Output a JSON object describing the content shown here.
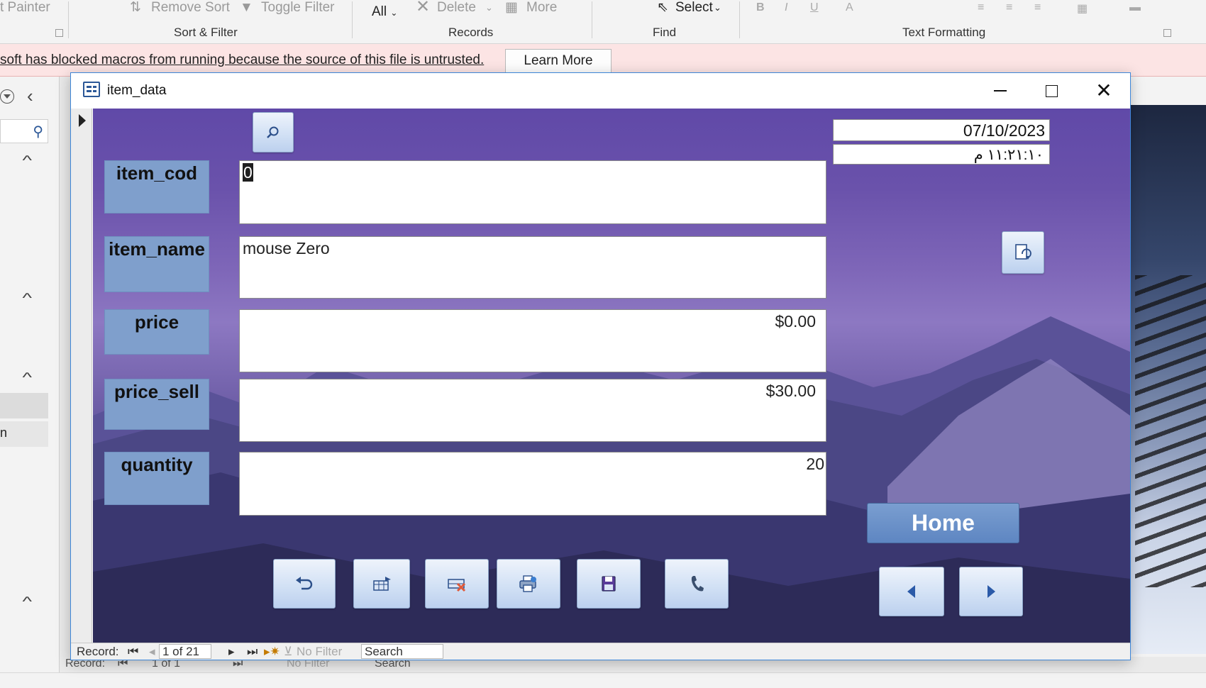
{
  "ribbon": {
    "painter_label": "t Painter",
    "remove_sort_label": "Remove Sort",
    "toggle_filter_label": "Toggle Filter",
    "all_label": "All",
    "delete_label": "Delete",
    "more_label": "More",
    "select_label": "Select",
    "groups": {
      "sort_filter": "Sort & Filter",
      "records": "Records",
      "find": "Find",
      "text_formatting": "Text Formatting"
    }
  },
  "message_bar": {
    "text": "soft has blocked macros from running because the source of this file is untrusted.",
    "learn_more_label": "Learn More"
  },
  "nav_pane": {
    "partial_item_text": "n"
  },
  "window": {
    "title": "item_data",
    "close_glyph": "✕"
  },
  "form": {
    "date": "07/10/2023",
    "time": "١١:٢١:١٠ م",
    "home_label": "Home",
    "fields": [
      {
        "label": "item_cod",
        "value": "0",
        "align": "left"
      },
      {
        "label": "item_name",
        "value": "mouse Zero",
        "align": "left"
      },
      {
        "label": "price",
        "value": "$0.00",
        "align": "right"
      },
      {
        "label": "price_sell",
        "value": "$30.00",
        "align": "right"
      },
      {
        "label": "quantity",
        "value": "20",
        "align": "right"
      }
    ]
  },
  "record_nav": {
    "record_label": "Record:",
    "position": "1 of 21",
    "filter_label": "No Filter",
    "search_label": "Search"
  },
  "behind_record_nav": {
    "record_label": "Record:",
    "position": "1 of 1",
    "filter_label": "No Filter",
    "search_label": "Search"
  },
  "colors": {
    "label_bg": "#7f9fcc",
    "home_bg": "#5e86c2",
    "message_bar_bg": "#fce4e4",
    "window_border": "#3d86d8"
  }
}
